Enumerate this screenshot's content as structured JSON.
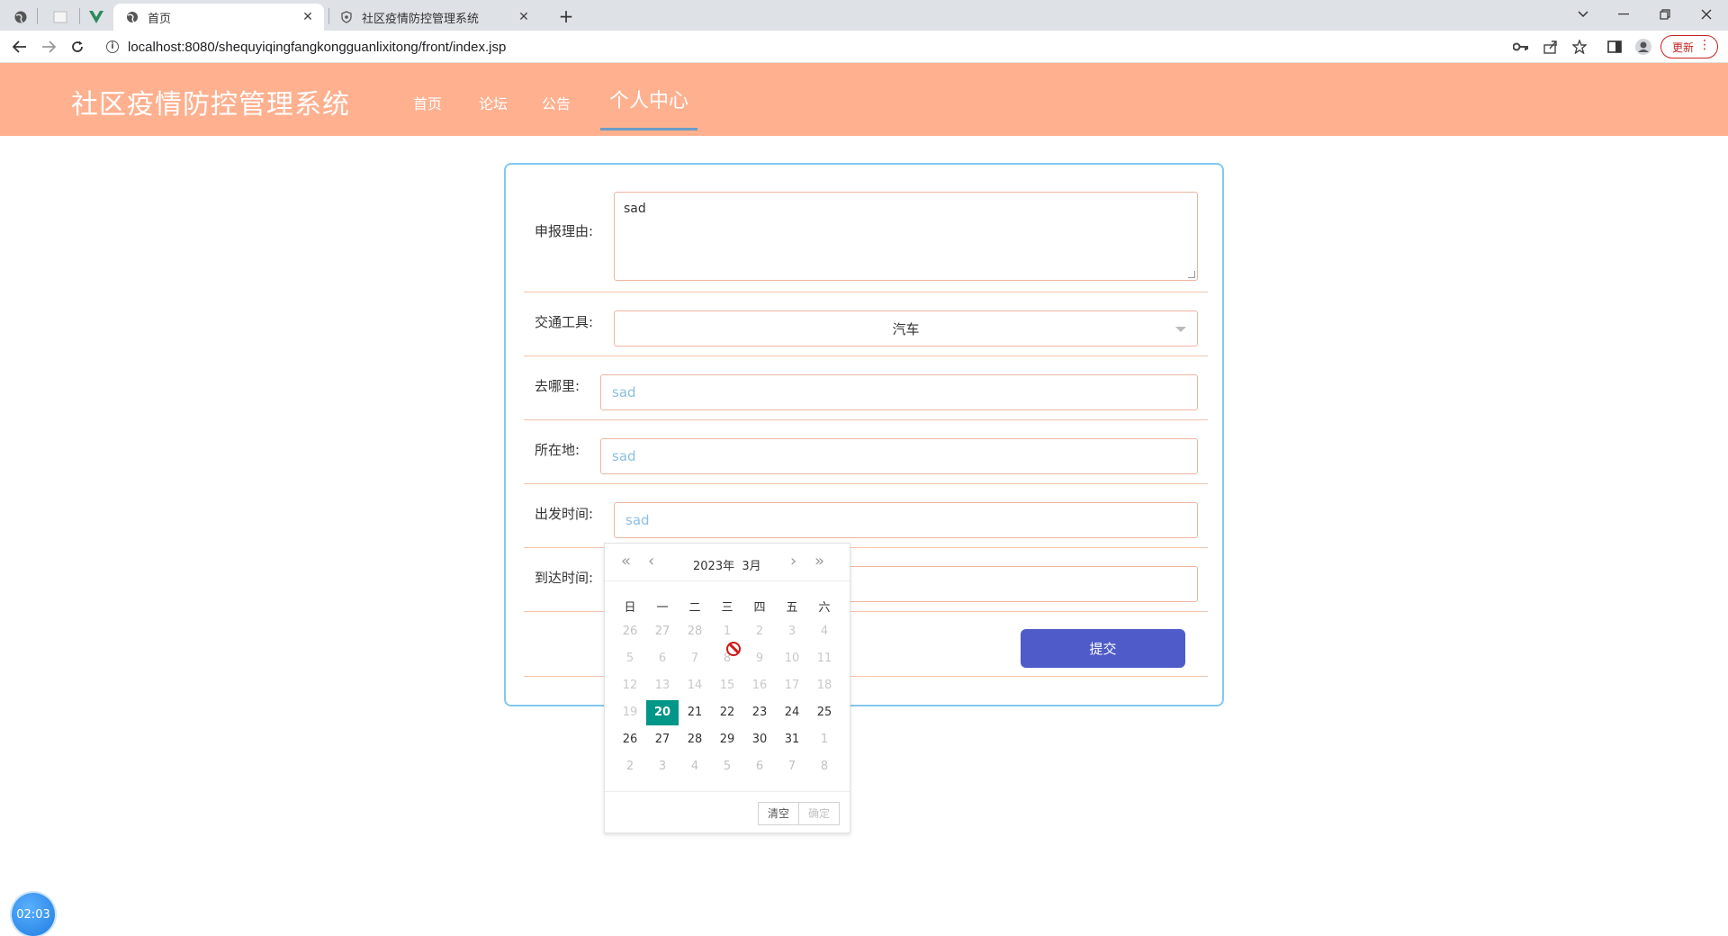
{
  "browser": {
    "tabs": [
      {
        "title": "首页",
        "active": true
      },
      {
        "title": "社区疫情防控管理系统",
        "active": false
      }
    ],
    "url": "localhost:8080/shequyiqingfangkongguanlixitong/front/index.jsp",
    "update_label": "更新"
  },
  "site": {
    "title": "社区疫情防控管理系统",
    "nav": [
      "首页",
      "论坛",
      "公告",
      "个人中心"
    ],
    "active_nav": "个人中心"
  },
  "form": {
    "reason": {
      "label": "申报理由:",
      "value": "sad"
    },
    "transport": {
      "label": "交通工具:",
      "value": "汽车"
    },
    "destination": {
      "label": "去哪里:",
      "value": "sad"
    },
    "location": {
      "label": "所在地:",
      "value": "sad"
    },
    "departure": {
      "label": "出发时间:",
      "value": "sad"
    },
    "arrival": {
      "label": "到达时间:",
      "value": ""
    },
    "submit_label": "提交"
  },
  "datepicker": {
    "year_label": "2023年",
    "month_label": "3月",
    "weekdays": [
      "日",
      "一",
      "二",
      "三",
      "四",
      "五",
      "六"
    ],
    "weeks": [
      [
        "26",
        "27",
        "28",
        "1",
        "2",
        "3",
        "4"
      ],
      [
        "5",
        "6",
        "7",
        "8",
        "9",
        "10",
        "11"
      ],
      [
        "12",
        "13",
        "14",
        "15",
        "16",
        "17",
        "18"
      ],
      [
        "19",
        "20",
        "21",
        "22",
        "23",
        "24",
        "25"
      ],
      [
        "26",
        "27",
        "28",
        "29",
        "30",
        "31",
        "1"
      ],
      [
        "2",
        "3",
        "4",
        "5",
        "6",
        "7",
        "8"
      ]
    ],
    "selected": "20",
    "clear_label": "清空",
    "confirm_label": "确定",
    "accent_color": "#009688"
  },
  "timer": {
    "value": "02:03"
  },
  "colors": {
    "header_bg": "#ffb08f",
    "card_border": "#83c8f0",
    "submit_bg": "#4e5bc8"
  }
}
